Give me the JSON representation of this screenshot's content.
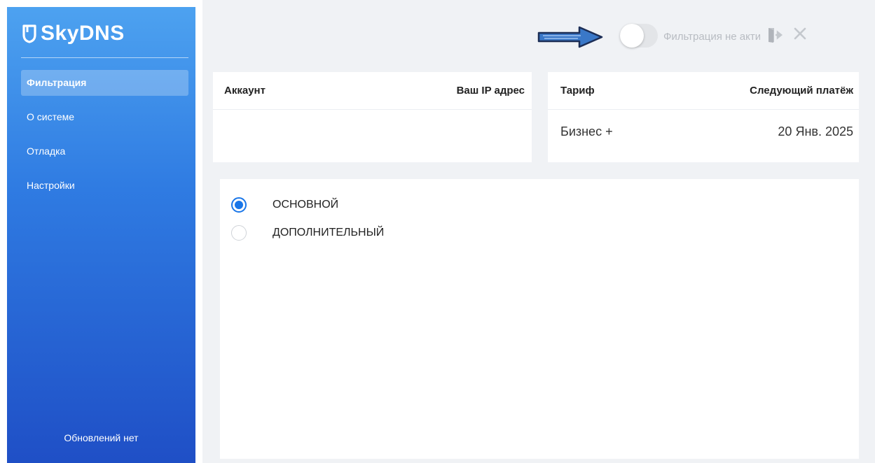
{
  "app": {
    "logo_text": "SkyDNS"
  },
  "sidebar": {
    "items": [
      {
        "label": "Фильтрация",
        "active": true
      },
      {
        "label": "О системе",
        "active": false
      },
      {
        "label": "Отладка",
        "active": false
      },
      {
        "label": "Настройки",
        "active": false
      }
    ],
    "footer": "Обновлений нет"
  },
  "topbar": {
    "filter_toggle_on": false,
    "filter_status": "Фильтрация не активна",
    "icons": [
      "arrow-right-icon",
      "exit-icon",
      "close-icon"
    ]
  },
  "account_card": {
    "account_label": "Аккаунт",
    "ip_label": "Ваш IP адрес",
    "account_value": "",
    "ip_value": ""
  },
  "tariff_card": {
    "tariff_label": "Тариф",
    "next_payment_label": "Следующий платёж",
    "tariff_value": "Бизнес +",
    "next_payment_value": "20 Янв. 2025"
  },
  "profiles": {
    "options": [
      {
        "label": "ОСНОВНОЙ",
        "checked": true
      },
      {
        "label": "ДОПОЛНИТЕЛЬНЫЙ",
        "checked": false
      }
    ]
  },
  "colors": {
    "accent": "#1976e8",
    "sidebar_top": "#4da2f0",
    "sidebar_bottom": "#1f4fc6",
    "background": "#f0f2f5"
  }
}
